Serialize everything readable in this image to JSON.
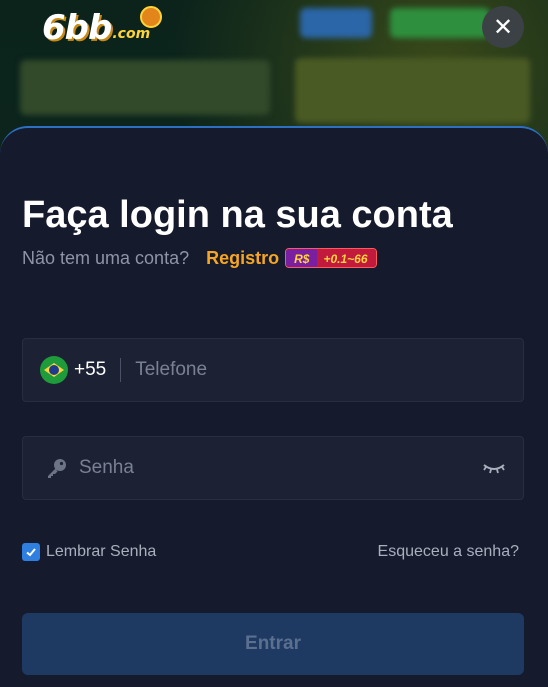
{
  "header": {
    "logo_main": "6bb",
    "logo_sub": ".com",
    "close_icon": "close-icon"
  },
  "login": {
    "title": "Faça login na sua conta",
    "no_account_text": "Não tem uma conta?",
    "register_label": "Registro",
    "bonus_currency": "R$",
    "bonus_value": "+0.1~66"
  },
  "phone": {
    "flag_icon": "brazil-flag-icon",
    "country_code": "+55",
    "placeholder": "Telefone",
    "value": ""
  },
  "password": {
    "key_icon": "key-icon",
    "placeholder": "Senha",
    "value": "",
    "toggle_icon": "eye-closed-icon"
  },
  "options": {
    "remember_label": "Lembrar Senha",
    "remember_checked": true,
    "forgot_label": "Esqueceu a senha?"
  },
  "submit": {
    "label": "Entrar"
  },
  "colors": {
    "modal_bg": "#151a2d",
    "accent_orange": "#f5a623",
    "accent_blue": "#2f7fe0",
    "button_disabled": "#1e3a63"
  }
}
